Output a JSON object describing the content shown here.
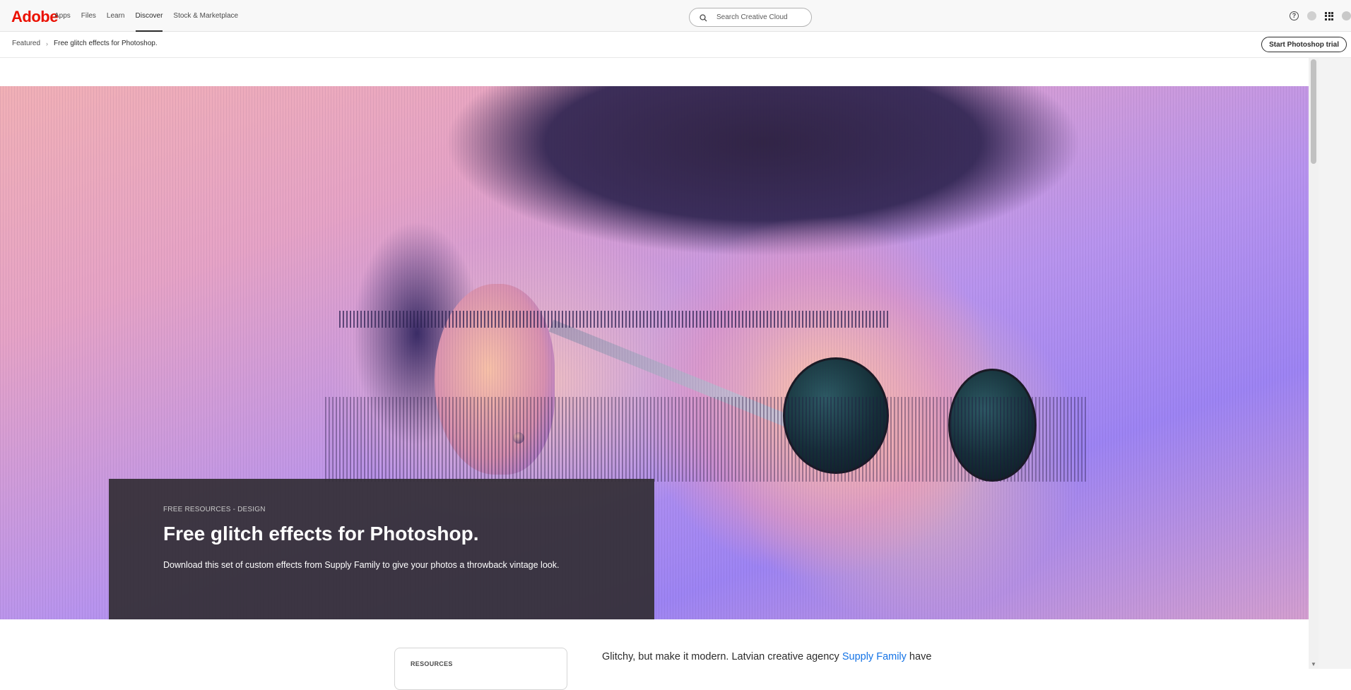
{
  "header": {
    "logo": "Adobe",
    "nav": [
      "Apps",
      "Files",
      "Learn",
      "Discover",
      "Stock & Marketplace"
    ],
    "active_nav": "Discover",
    "search_placeholder": "Search Creative Cloud",
    "help_icon_glyph": "?"
  },
  "subnav": {
    "breadcrumb_parent": "Featured",
    "breadcrumb_separator": "›",
    "breadcrumb_current": "Free glitch effects for Photoshop.",
    "trial_button": "Start Photoshop trial"
  },
  "hero": {
    "eyebrow": "FREE RESOURCES - DESIGN",
    "title": "Free glitch effects for Photoshop.",
    "description": "Download this set of custom effects from Supply Family to give your photos a throwback vintage look."
  },
  "article": {
    "resources_label": "RESOURCES",
    "intro_text_before_link": "Glitchy, but make it modern. Latvian creative agency ",
    "intro_link": "Supply Family",
    "intro_text_after_link": " have"
  },
  "colors": {
    "brand": "#eb1000",
    "link": "#1473e6",
    "hero_card": "#322e34"
  }
}
